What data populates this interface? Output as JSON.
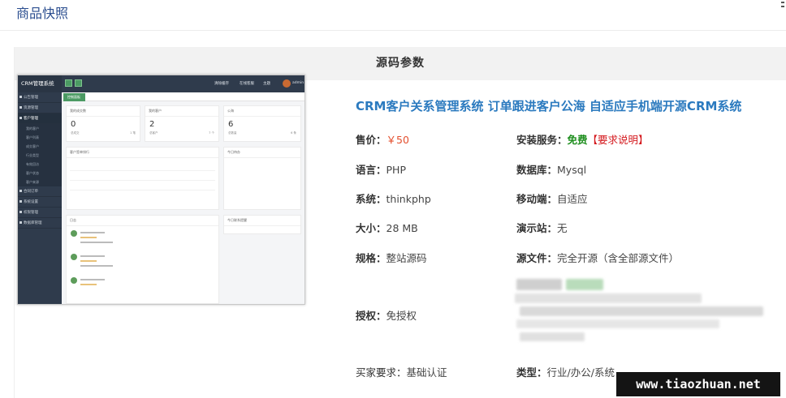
{
  "header": {
    "title": "商品快照"
  },
  "panel": {
    "heading": "源码参数"
  },
  "product": {
    "title": "CRM客户关系管理系统 订单跟进客户公海 自适应手机端开源CRM系统",
    "fields": {
      "price_label": "售价：",
      "price_value": "￥50",
      "install_label": "安装服务：",
      "install_value": "免费",
      "install_note": "【要求说明】",
      "lang_label": "语言：",
      "lang_value": "PHP",
      "db_label": "数据库：",
      "db_value": "Mysql",
      "sys_label": "系统：",
      "sys_value": "thinkphp",
      "mobile_label": "移动端：",
      "mobile_value": "自适应",
      "size_label": "大小：",
      "size_value": "28 MB",
      "demo_label": "演示站：",
      "demo_value": "无",
      "spec_label": "规格：",
      "spec_value": "整站源码",
      "src_label": "源文件：",
      "src_value": "完全开源（含全部源文件）",
      "auth_label": "授权：",
      "auth_value": "免授权",
      "buyer_label": "买家要求：",
      "buyer_value": "基础认证",
      "type_label": "类型：",
      "type_value": "行业/办公/系统"
    }
  },
  "preview": {
    "logo": "CRM管理系统",
    "nav": [
      "公告管理",
      "资源管理",
      "客户管理",
      "合同订单",
      "系统设置",
      "权限管理",
      "数据库管理"
    ],
    "subnav": [
      "我的客户",
      "客户列表",
      "成交客户",
      "行业类型",
      "有效回访",
      "客户状态",
      "客户来源"
    ],
    "top_links": [
      "清除缓存",
      "在线客服",
      "主题",
      "admin"
    ],
    "tab": "控制面板",
    "cards": [
      {
        "caption": "我的成交数",
        "num": "0",
        "foot_l": "总成交",
        "foot_r": "1 笔"
      },
      {
        "caption": "我的客户",
        "num": "2",
        "foot_l": "总客户",
        "foot_r": "7 个"
      },
      {
        "caption": "公海",
        "num": "6",
        "foot_l": "总数量",
        "foot_r": "6 条"
      }
    ],
    "panels": [
      "客户签单排行",
      "今日待办",
      "日志",
      "今日联系提醒"
    ]
  },
  "watermark": {
    "text": "www.tiaozhuan.net"
  },
  "colors": {
    "title_blue": "#2b7abf",
    "price": "#e4502f",
    "free": "#1f8f1f",
    "note": "#d4181d",
    "header_link": "#2a4d8f"
  }
}
